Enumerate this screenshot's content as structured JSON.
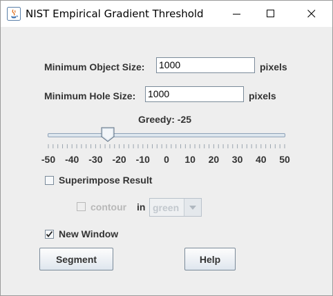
{
  "window": {
    "title": "NIST Empirical Gradient Threshold",
    "controls": {
      "minimize_icon": "minimize-icon",
      "maximize_icon": "maximize-icon",
      "close_icon": "close-icon"
    }
  },
  "min_object": {
    "label": "Minimum Object Size:",
    "value": "1000",
    "unit": "pixels"
  },
  "min_hole": {
    "label": "Minimum Hole Size:",
    "value": "1000",
    "unit": "pixels"
  },
  "greedy": {
    "label": "Greedy: -25",
    "value": -25,
    "min": -50,
    "max": 50,
    "tick_labels": [
      "-50",
      "-40",
      "-30",
      "-20",
      "-10",
      "0",
      "10",
      "20",
      "30",
      "40",
      "50"
    ]
  },
  "superimpose": {
    "label": "Superimpose Result",
    "checked": false
  },
  "contour": {
    "label": "contour",
    "checked": false,
    "enabled": false,
    "in_label": "in",
    "color_value": "green"
  },
  "new_window": {
    "label": "New Window",
    "checked": true
  },
  "buttons": {
    "segment": "Segment",
    "help": "Help"
  }
}
